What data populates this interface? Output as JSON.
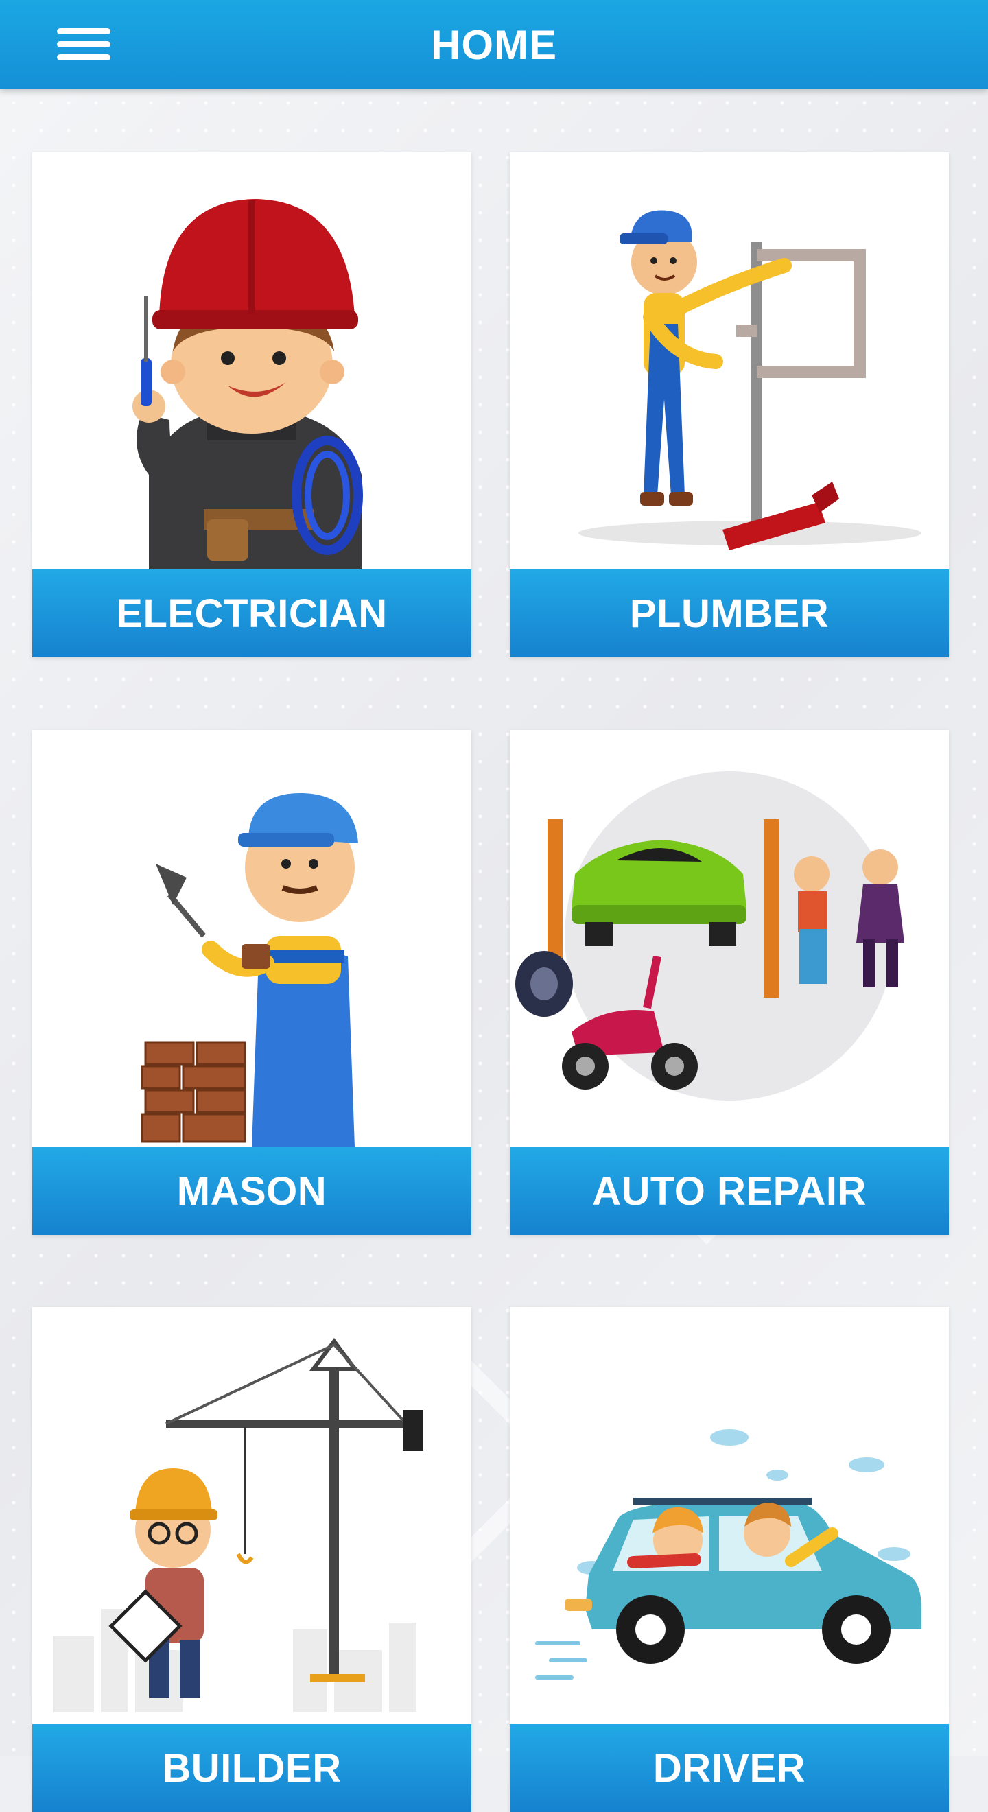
{
  "header": {
    "title": "HOME",
    "menu_icon": "hamburger-menu-icon"
  },
  "categories": [
    {
      "label": "ELECTRICIAN",
      "icon": "electrician-illustration"
    },
    {
      "label": "PLUMBER",
      "icon": "plumber-illustration"
    },
    {
      "label": "MASON",
      "icon": "mason-illustration"
    },
    {
      "label": "AUTO REPAIR",
      "icon": "auto-repair-illustration"
    },
    {
      "label": "BUILDER",
      "icon": "builder-illustration"
    },
    {
      "label": "DRIVER",
      "icon": "driver-illustration"
    }
  ],
  "colors": {
    "header": "#1ba7e3",
    "label_bar": "#1a8fd6",
    "background": "#eeeff2"
  }
}
